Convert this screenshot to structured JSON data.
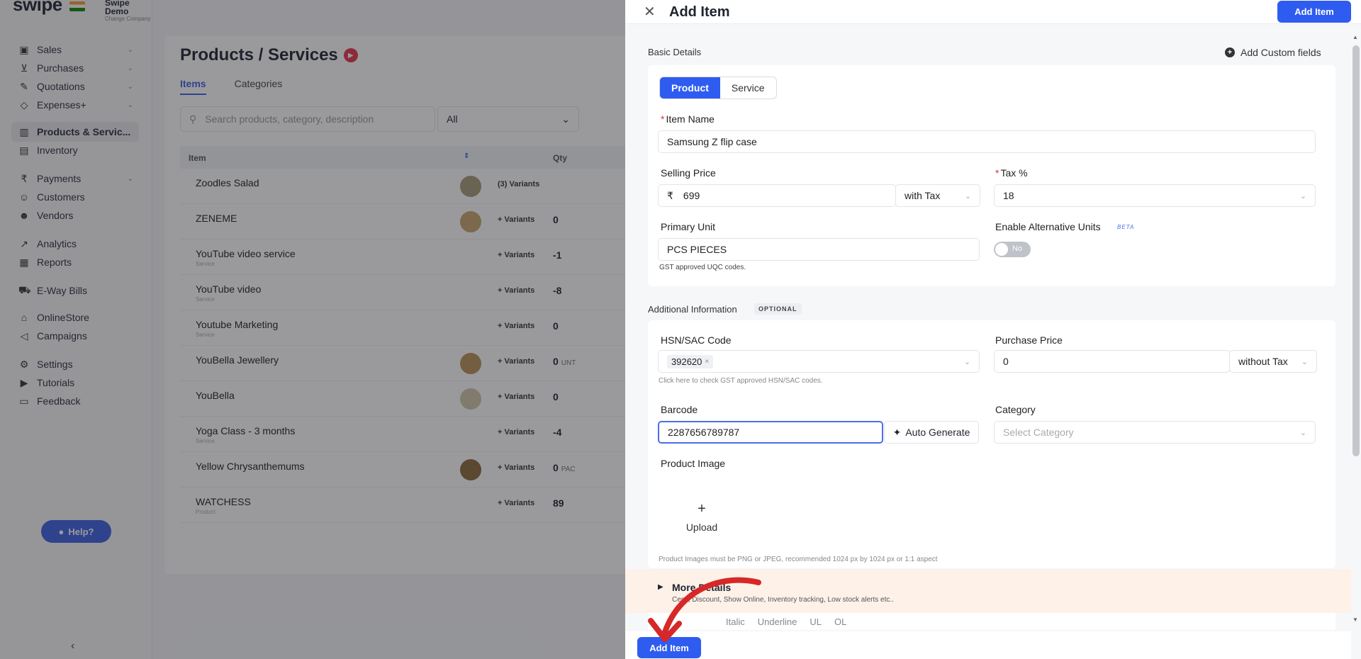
{
  "app": {
    "brand": "swipe",
    "company_name": "Swipe Demo",
    "company_sub": "Change Company"
  },
  "sidebar": {
    "items": [
      {
        "label": "Sales",
        "icon": "sales-icon"
      },
      {
        "label": "Purchases",
        "icon": "cart-icon"
      },
      {
        "label": "Quotations",
        "icon": "pen-icon"
      },
      {
        "label": "Expenses+",
        "icon": "tag-icon"
      },
      {
        "label": "Products & Servic...",
        "icon": "barcode-icon"
      },
      {
        "label": "Inventory",
        "icon": "inventory-icon"
      },
      {
        "label": "Payments",
        "icon": "rupee-icon"
      },
      {
        "label": "Customers",
        "icon": "user-icon"
      },
      {
        "label": "Vendors",
        "icon": "users-icon"
      },
      {
        "label": "Analytics",
        "icon": "chart-icon"
      },
      {
        "label": "Reports",
        "icon": "report-icon"
      },
      {
        "label": "E-Way Bills",
        "icon": "truck-icon"
      },
      {
        "label": "OnlineStore",
        "icon": "store-icon"
      },
      {
        "label": "Campaigns",
        "icon": "megaphone-icon"
      },
      {
        "label": "Settings",
        "icon": "gear-icon"
      },
      {
        "label": "Tutorials",
        "icon": "youtube-icon"
      },
      {
        "label": "Feedback",
        "icon": "chat-icon"
      }
    ],
    "help_label": "Help?"
  },
  "products_page": {
    "title": "Products / Services",
    "tabs": [
      "Items",
      "Categories"
    ],
    "search_placeholder": "Search products, category, description",
    "filter_value": "All",
    "columns": [
      "Item",
      "Qty"
    ],
    "rows": [
      {
        "name": "Zoodles Salad",
        "variants": "(3) Variants",
        "qty": ""
      },
      {
        "name": "ZENEME",
        "variants": "+ Variants",
        "qty": "0"
      },
      {
        "name": "YouTube video service",
        "sub": "Service",
        "variants": "+ Variants",
        "qty": "-1"
      },
      {
        "name": "YouTube video",
        "sub": "Service",
        "variants": "+ Variants",
        "qty": "-8"
      },
      {
        "name": "Youtube Marketing",
        "sub": "Service",
        "variants": "+ Variants",
        "qty": "0"
      },
      {
        "name": "YouBella Jewellery",
        "variants": "+ Variants",
        "qty": "0",
        "unit": "UNT"
      },
      {
        "name": "YouBella",
        "variants": "+ Variants",
        "qty": "0"
      },
      {
        "name": "Yoga Class - 3 months",
        "sub": "Service",
        "variants": "+ Variants",
        "qty": "-4"
      },
      {
        "name": "Yellow Chrysanthemums",
        "variants": "+ Variants",
        "qty": "0",
        "unit": "PAC"
      },
      {
        "name": "WATCHESS",
        "sub": "Product",
        "variants": "+ Variants",
        "qty": "89"
      }
    ]
  },
  "drawer": {
    "title": "Add Item",
    "add_button": "Add Item",
    "basic_details": "Basic Details",
    "add_custom_fields": "Add Custom fields",
    "type_options": [
      "Product",
      "Service"
    ],
    "item_name_label": "Item Name",
    "item_name_value": "Samsung Z flip case",
    "selling_price_label": "Selling Price",
    "currency": "₹",
    "selling_price_value": "699",
    "price_tax_mode": "with Tax",
    "tax_label": "Tax %",
    "tax_value": "18",
    "primary_unit_label": "Primary Unit",
    "primary_unit_value": "PCS PIECES",
    "uqc_hint": "GST approved UQC codes.",
    "alt_units_label": "Enable Alternative Units",
    "beta": "BETA",
    "toggle_state": "No",
    "additional_info": "Additional Information",
    "optional": "OPTIONAL",
    "hsn_label": "HSN/SAC Code",
    "hsn_value": "392620",
    "hsn_hint": "Click here to check GST approved HSN/SAC codes.",
    "purchase_price_label": "Purchase Price",
    "purchase_price_value": "0",
    "purchase_tax_mode": "without Tax",
    "barcode_label": "Barcode",
    "barcode_value": "2287656789787",
    "auto_generate": "Auto Generate",
    "category_label": "Category",
    "category_placeholder": "Select Category",
    "product_image_label": "Product Image",
    "upload_label": "Upload",
    "image_hint": "Product Images must be PNG or JPEG, recommended 1024 px by 1024 px or 1:1 aspect",
    "more_details_title": "More Details",
    "more_details_sub": "Cess, Discount, Show Online, Inventory tracking, Low stock alerts etc..",
    "editor_tools": [
      "Italic",
      "Underline",
      "UL",
      "OL"
    ],
    "footer_add_button": "Add Item"
  },
  "colors": {
    "primary": "#2f5cf0",
    "required": "#e0323c",
    "annotation_arrow": "#d62828"
  }
}
